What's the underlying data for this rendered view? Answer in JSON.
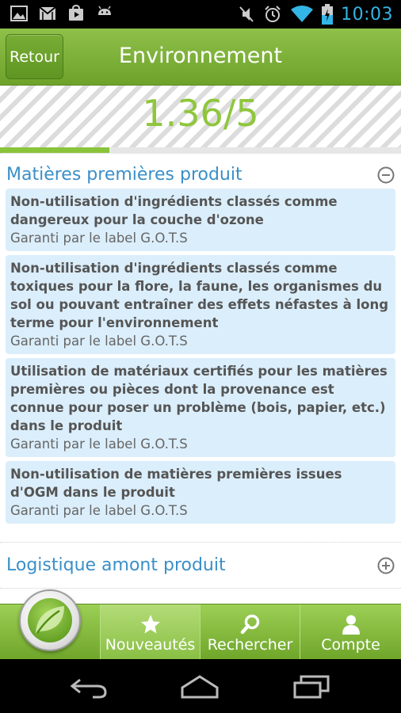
{
  "status_bar": {
    "time": "10:03",
    "left_icons": [
      "image-icon",
      "gmail-icon",
      "play-store-icon",
      "android-icon"
    ],
    "right_icons": [
      "mute-icon",
      "alarm-icon",
      "wifi-icon",
      "battery-icon"
    ]
  },
  "action_bar": {
    "back_label": "Retour",
    "title": "Environnement"
  },
  "score": {
    "value": "1.36/5",
    "progress_fraction": 0.272
  },
  "sections": [
    {
      "title": "Matières premières produit",
      "toggle_icon": "collapse-minus-icon",
      "items": [
        {
          "title": "Non-utilisation d'ingrédients classés comme dangereux pour la couche d'ozone",
          "label": "Garanti par le label G.O.T.S"
        },
        {
          "title": "Non-utilisation d'ingrédients classés comme toxiques pour la flore, la faune, les organismes du sol ou pouvant entraîner des effets néfastes à long terme pour l'environnement",
          "label": "Garanti par le label G.O.T.S"
        },
        {
          "title": "Utilisation de matériaux certifiés pour les matières premières ou pièces dont la provenance est connue pour poser un problème (bois, papier, etc.) dans le produit",
          "label": "Garanti par le label G.O.T.S"
        },
        {
          "title": "Non-utilisation de matières premières issues d'OGM dans le produit",
          "label": "Garanti par le label G.O.T.S"
        }
      ]
    },
    {
      "title": "Logistique amont produit",
      "toggle_icon": "expand-plus-icon"
    }
  ],
  "tab_bar": {
    "logo_icon": "leaf-logo-icon",
    "tabs": [
      {
        "label": "Nouveautés",
        "icon": "star-icon"
      },
      {
        "label": "Rechercher",
        "icon": "search-icon"
      },
      {
        "label": "Compte",
        "icon": "user-icon"
      }
    ]
  },
  "nav_bar": {
    "icons": [
      "back-nav-icon",
      "home-nav-icon",
      "recents-nav-icon"
    ]
  },
  "colors": {
    "brand_green": "#7bb035",
    "score_green": "#8fc63c",
    "section_blue": "#3a8fc8",
    "item_bg": "#dbeefb",
    "status_time": "#33b5e5"
  }
}
